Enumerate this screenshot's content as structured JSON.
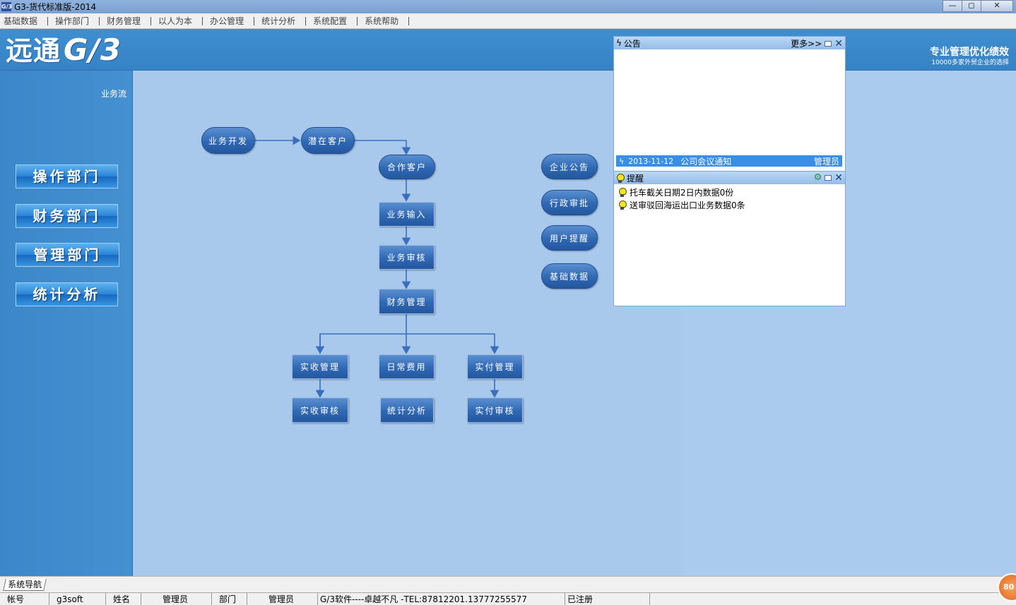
{
  "window": {
    "icon_text": "G/3",
    "title": "G3-货代标准版-2014",
    "buttons": [
      "—",
      "◻",
      "✕"
    ]
  },
  "menu": [
    "基础数据",
    "操作部门",
    "财务管理",
    "以人为本",
    "办公管理",
    "统计分析",
    "系统配置",
    "系统帮助"
  ],
  "banner": {
    "logo_cn": "远通",
    "logo_g3": "G/3",
    "slogan_main": "专业管理优化绩效",
    "slogan_sub": "10000多家外贸企业的选择"
  },
  "sidebar": {
    "title": "业务流",
    "buttons": [
      "操作部门",
      "财务部门",
      "管理部门",
      "统计分析"
    ]
  },
  "flow": {
    "biz_dev": "业务开发",
    "potential": "潜在客户",
    "partner": "合作客户",
    "biz_input": "业务输入",
    "biz_audit": "业务审核",
    "finance": "财务管理",
    "receive_mgmt": "实收管理",
    "daily_cost": "日常费用",
    "pay_mgmt": "实付管理",
    "receive_audit": "实收审核",
    "stats": "统计分析",
    "pay_audit": "实付审核",
    "notice": "企业公告",
    "admin_approve": "行政审批",
    "user_remind": "用户提醒",
    "base_data": "基础数据"
  },
  "notice_panel": {
    "title": "公告",
    "more": "更多>>",
    "row": {
      "date": "2013-11-12",
      "subject": "公司会议通知",
      "author": "管理员"
    }
  },
  "remind_panel": {
    "title": "提醒",
    "items": [
      "托车截关日期2日内数据0份",
      "送审驳回海运出口业务数据0条"
    ]
  },
  "nav_tab": "系统导航",
  "status": {
    "account_label": "帐号",
    "account": "g3soft",
    "name_label": "姓名",
    "name": "管理员",
    "dept_label": "部门",
    "dept": "管理员",
    "info": "G/3软件----卓越不凡 -TEL:87812201.13777255577",
    "registered": "已注册"
  },
  "orb_text": "80"
}
